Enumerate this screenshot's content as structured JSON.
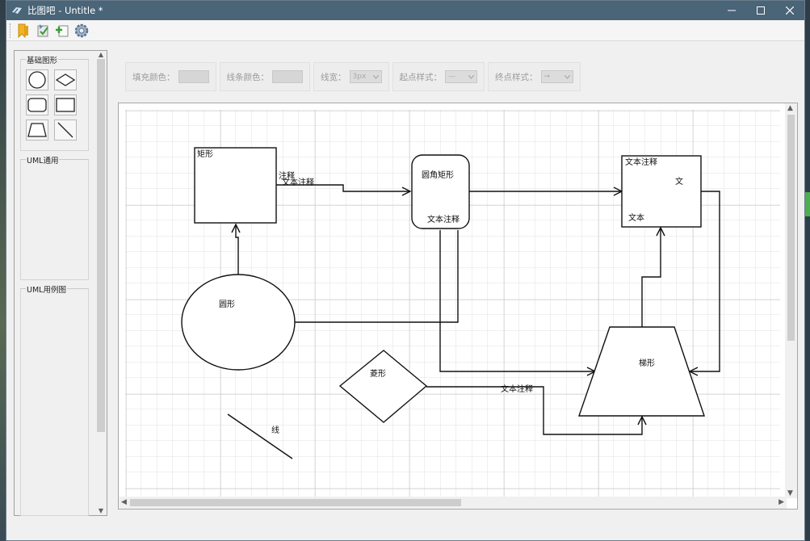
{
  "window": {
    "title": "比图吧 - Untitle *"
  },
  "toolbar": {
    "icons": [
      "bookmark-icon",
      "save-icon",
      "new-icon",
      "settings-icon"
    ]
  },
  "sidepanel": {
    "groups": [
      {
        "title": "基础图形",
        "shapes": [
          "circle",
          "diamond",
          "rounded-rect",
          "rect",
          "trapezoid",
          "line"
        ]
      },
      {
        "title": "UML通用"
      },
      {
        "title": "UML用例图"
      }
    ]
  },
  "props": {
    "fill_label": "填充颜色：",
    "line_color_label": "线条颜色：",
    "width_label": "线宽：",
    "width_value": "3px",
    "start_label": "起点样式：",
    "start_value": "—",
    "end_label": "终点样式：",
    "end_value": "→"
  },
  "diagram": {
    "rect_label": "矩形",
    "rect_note1": "注释",
    "rect_note2": "文本注释",
    "rounded_label": "圆角矩形",
    "rounded_note": "文本注释",
    "textbox_label": "文本注释",
    "textbox_text1": "文",
    "textbox_text2": "文本",
    "ellipse_label": "圆形",
    "diamond_label": "菱形",
    "diamond_note": "文本注释",
    "trapezoid_label": "梯形",
    "line_label": "线"
  },
  "colors": {
    "titlebar": "#4a6478",
    "grid_minor": "#dedede",
    "grid_major": "#c8c8c8"
  }
}
